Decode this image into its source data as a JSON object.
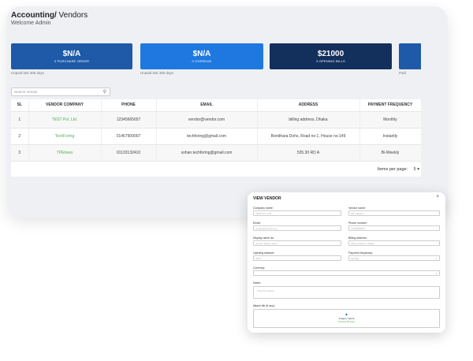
{
  "header": {
    "breadcrumb_main": "Accounting/",
    "breadcrumb_sub": " Vendors",
    "welcome": "Welcome Admin"
  },
  "stats": [
    {
      "value": "$N/A",
      "label": "0 PURCHASE ORDER",
      "color": "#1e5aa8"
    },
    {
      "value": "$N/A",
      "label": "0 OVERDUE",
      "color": "#1e78e0"
    },
    {
      "value": "$21000",
      "label": "3 OPENING BILLS",
      "color": "#132f5c"
    },
    {
      "value": "",
      "label": "",
      "color": "#1e5aa8"
    }
  ],
  "stat_notes": [
    "Unpaid last 365 days",
    "Unpaid last 365 days",
    "Paid"
  ],
  "search": {
    "placeholder": "Search Vendor"
  },
  "table": {
    "headers": [
      "SL",
      "VENDOR COMPANY",
      "PHONE",
      "EMAIL",
      "ADDRESS",
      "PAYMENT FREQUENCY"
    ],
    "rows": [
      {
        "sl": "1",
        "company": "TEST Pvt. Ltd.",
        "phone": "12345665657",
        "email": "vendor@vendor.com",
        "address": "billing address, Dhaka",
        "frequency": "Monthly"
      },
      {
        "sl": "2",
        "company": "TechForing",
        "phone": "01467909007",
        "email": "techforing@gmail.com",
        "address": "Boridhara Dohs, Road no:1, House no:149",
        "frequency": "Instantly"
      },
      {
        "sl": "3",
        "company": "TPEtrees",
        "phone": "01133132410",
        "email": "sohan.techforing@gmail.com",
        "address": "535.30 RD A",
        "frequency": "Bi-Weekly"
      }
    ]
  },
  "pager": {
    "label": "Items per page:",
    "value": "5"
  },
  "modal": {
    "title": "VIEW VENDOR",
    "close": "×",
    "fields": {
      "company_name": {
        "label": "Company name:",
        "placeholder": "TEST Pvt. LTD."
      },
      "vendor_name": {
        "label": "Vendor name:",
        "placeholder": "MR. Haisem"
      },
      "email": {
        "label": "Email:",
        "placeholder": "vendor@vendor.com"
      },
      "phone": {
        "label": "Phone number:",
        "placeholder": "12345665657"
      },
      "display_name": {
        "label": "Display name as:",
        "placeholder": "vendor display name"
      },
      "billing_address": {
        "label": "Billing address:",
        "placeholder": "billing address, Dhaka"
      },
      "opening_balance": {
        "label": "Opening balance:",
        "placeholder": "2000"
      },
      "payment_frequency": {
        "label": "Payment frequency:",
        "placeholder": "Monthly"
      },
      "currency": {
        "label": "Currency:",
        "placeholder": ""
      },
      "notes": {
        "label": "Notes:",
        "placeholder": "notes for vendor"
      },
      "attach": {
        "label": "Attach file (if any):",
        "upload_text": "Images, Figma",
        "upload_sub": "Choose Browse"
      }
    }
  }
}
